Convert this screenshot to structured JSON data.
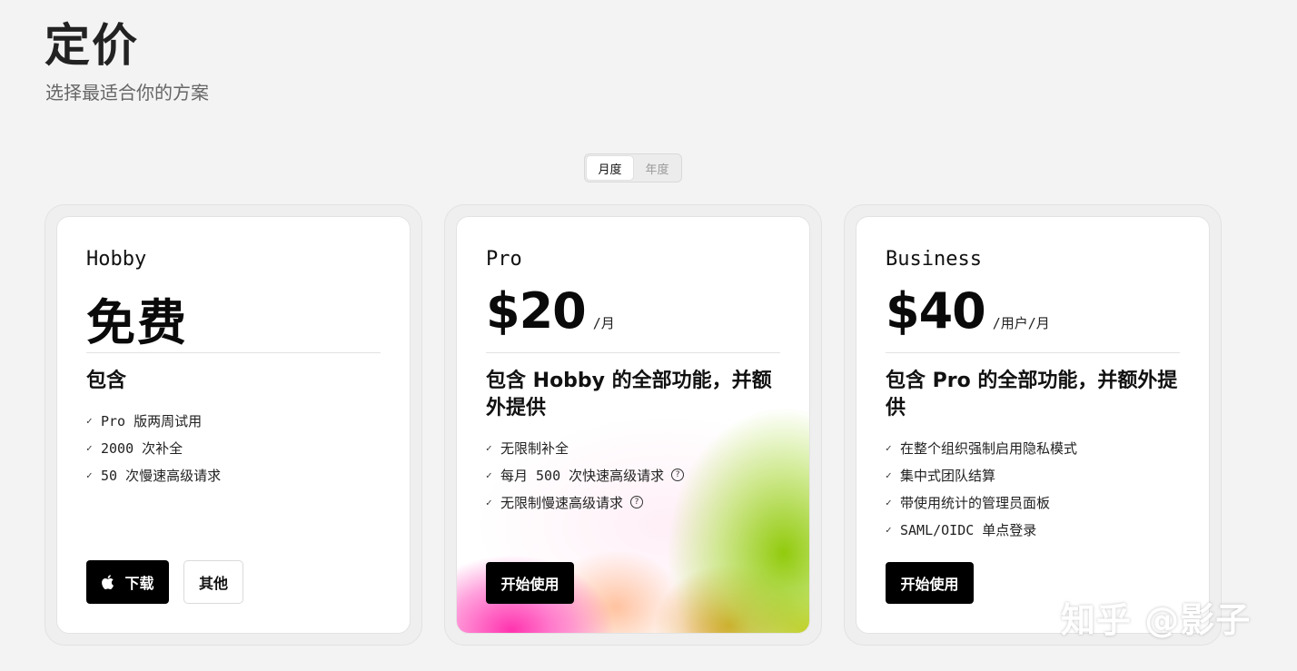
{
  "header": {
    "title": "定价",
    "subtitle": "选择最适合你的方案"
  },
  "billing_toggle": {
    "options": [
      "月度",
      "年度"
    ],
    "selected": "月度"
  },
  "plans": [
    {
      "name": "Hobby",
      "price": "免费",
      "unit": "",
      "includes": "包含",
      "features": [
        "Pro 版两周试用",
        "2000 次补全",
        "50 次慢速高级请求"
      ],
      "buttons": {
        "primary": "下载",
        "primary_icon": "apple-icon",
        "secondary": "其他"
      }
    },
    {
      "name": "Pro",
      "price": "$20",
      "unit": "/月",
      "includes": "包含 Hobby 的全部功能，并额外提供",
      "features": [
        "无限制补全",
        "每月 500 次快速高级请求",
        "无限制慢速高级请求"
      ],
      "buttons": {
        "primary": "开始使用"
      }
    },
    {
      "name": "Business",
      "price": "$40",
      "unit": "/用户/月",
      "includes": "包含 Pro 的全部功能，并额外提供",
      "features": [
        "在整个组织强制启用隐私模式",
        "集中式团队结算",
        "带使用统计的管理员面板",
        "SAML/OIDC 单点登录"
      ],
      "buttons": {
        "primary": "开始使用"
      }
    }
  ],
  "watermark": "知乎 @影子",
  "colors": {
    "background": "#f3f3f3",
    "card": "#ffffff",
    "primary_button": "#000000",
    "gradient_pink": "#ff3fb0",
    "gradient_green": "#8cc800",
    "gradient_gold": "#d9a400"
  }
}
